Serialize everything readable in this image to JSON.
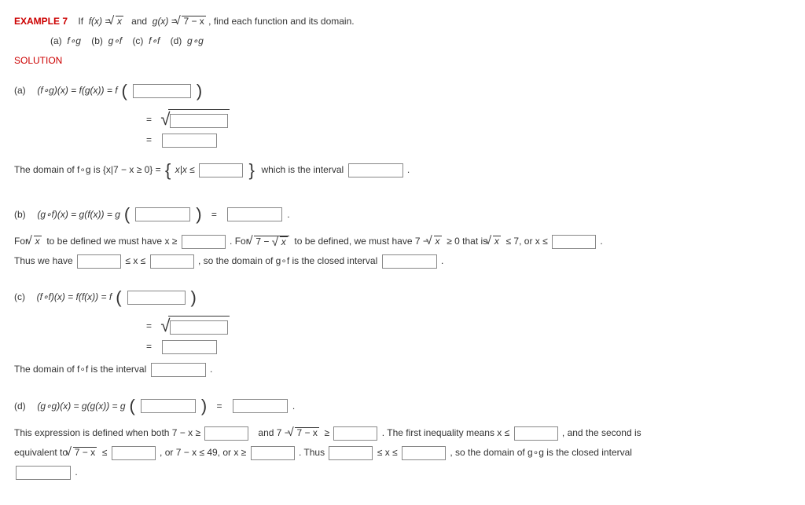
{
  "header": {
    "example_label": "EXAMPLE 7",
    "prompt_pre": "If",
    "f_eq": "f(x) =",
    "sqrt_x": "x",
    "and": "and",
    "g_eq": "g(x) =",
    "sqrt_7mx": "7 − x",
    "prompt_post": ", find each function and its domain.",
    "parts": {
      "a": "(a)",
      "b": "(b)",
      "c": "(c)",
      "d": "(d)",
      "fog": "f∘g",
      "gof": "g∘f",
      "fof": "f∘f",
      "gog": "g∘g"
    },
    "solution": "SOLUTION"
  },
  "partA": {
    "label": "(a)",
    "lhs": "(f∘g)(x) = f(g(x)) = f",
    "eq": "=",
    "domain_pre": "The domain of f∘g is  {x|7 − x ≥ 0}  =",
    "xbar": "x|x ≤",
    "domain_post": "which is the interval",
    "period": "."
  },
  "partB": {
    "label": "(b)",
    "lhs": "(g∘f)(x) = g(f(x)) = g",
    "eq": "=",
    "period": ".",
    "line2_pre": "For",
    "sqrt_x": "x",
    "line2_mid": "to be defined we must have  x ≥",
    "line2_for2": ".  For",
    "sqrt_7msx": "7 − ",
    "line2_after": "to be defined, we must have  7 −",
    "ge0": "≥ 0  that is",
    "le7": "≤ 7,  or  x ≤",
    "thus": "Thus we have",
    "lex_le": "≤ x ≤",
    "closed": ",   so the domain of g∘f is the closed interval"
  },
  "partC": {
    "label": "(c)",
    "lhs": "(f∘f)(x) = f(f(x)) = f",
    "eq": "=",
    "domain": "The domain of f∘f is the interval",
    "period": "."
  },
  "partD": {
    "label": "(d)",
    "lhs": "(g∘g)(x) = g(g(x)) = g",
    "eq": "=",
    "period": ".",
    "line2a": "This expression is defined when both  7 − x ≥",
    "and": "and  7 −",
    "sqrt_7mx": "7 − x",
    "ge": "≥",
    "first_ineq": ".  The first inequality means  x ≤",
    "second": ",   and the second is",
    "equiv": "equivalent to",
    "le": "≤",
    "or49": ",  or  7 − x ≤ 49,  or  x ≥",
    "thus": ".   Thus",
    "lexle": "≤ x ≤",
    "closed": ",   so the domain of g∘g  is the closed interval"
  }
}
